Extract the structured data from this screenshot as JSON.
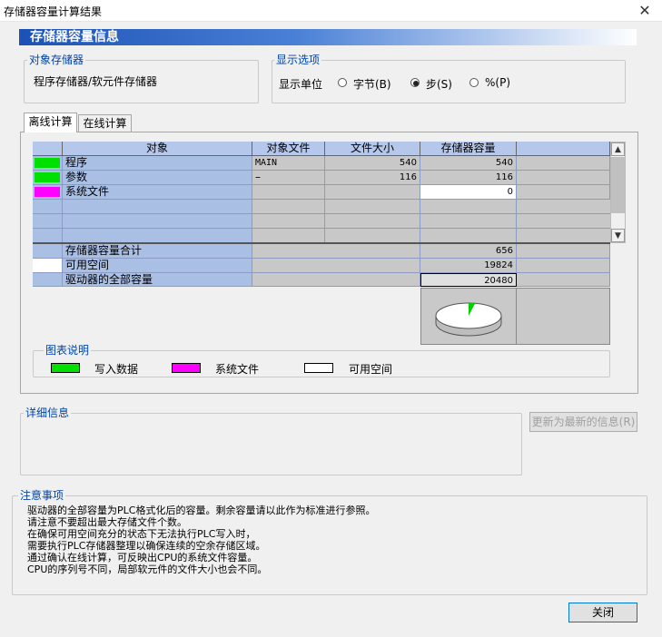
{
  "window": {
    "title": "存储器容量计算结果",
    "close_glyph": "✕"
  },
  "banner": {
    "title": "存储器容量信息"
  },
  "target": {
    "legend": "对象存储器",
    "value": "程序存储器/软元件存储器"
  },
  "display": {
    "legend": "显示选项",
    "unit_label": "显示单位",
    "options": [
      {
        "label": "字节(B)",
        "selected": false
      },
      {
        "label": "步(S)",
        "selected": true
      },
      {
        "label": "%(P)",
        "selected": false
      }
    ]
  },
  "tabs": [
    {
      "label": "离线计算",
      "active": true
    },
    {
      "label": "在线计算",
      "active": false
    }
  ],
  "table": {
    "headers": [
      "对象",
      "对象文件",
      "文件大小",
      "存储器容量"
    ],
    "rows": [
      {
        "color": "#00e000",
        "name": "程序",
        "file": "MAIN",
        "size": "540",
        "capacity": "540"
      },
      {
        "color": "#00e000",
        "name": "参数",
        "file": "–",
        "size": "116",
        "capacity": "116"
      },
      {
        "color": "#ff00ff",
        "name": "系统文件",
        "file": "",
        "size": "",
        "capacity": "0"
      }
    ],
    "summary": [
      {
        "color": "",
        "name": "存储器容量合计",
        "value": "656"
      },
      {
        "color": "#ffffff",
        "name": "可用空间",
        "value": "19824"
      },
      {
        "color": "",
        "name": "驱动器的全部容量",
        "value": "20480"
      }
    ]
  },
  "chart_legend": {
    "legend": "图表说明",
    "items": [
      {
        "color": "#00e000",
        "label": "写入数据"
      },
      {
        "color": "#ff00ff",
        "label": "系统文件"
      },
      {
        "color": "#ffffff",
        "label": "可用空间"
      }
    ]
  },
  "detail": {
    "legend": "详细信息",
    "refresh_label": "更新为最新的信息(R)"
  },
  "notes": {
    "legend": "注意事项",
    "lines": [
      "驱动器的全部容量为PLC格式化后的容量。剩余容量请以此作为标准进行参照。",
      "请注意不要超出最大存储文件个数。",
      "在确保可用空间充分的状态下无法执行PLC写入时，",
      "需要执行PLC存储器整理以确保连续的空余存储区域。",
      "通过确认在线计算，可反映出CPU的系统文件容量。",
      "CPU的序列号不同，局部软元件的文件大小也会不同。"
    ]
  },
  "close_button": {
    "label": "关闭"
  },
  "pie": {
    "used_fraction": 0.032
  }
}
